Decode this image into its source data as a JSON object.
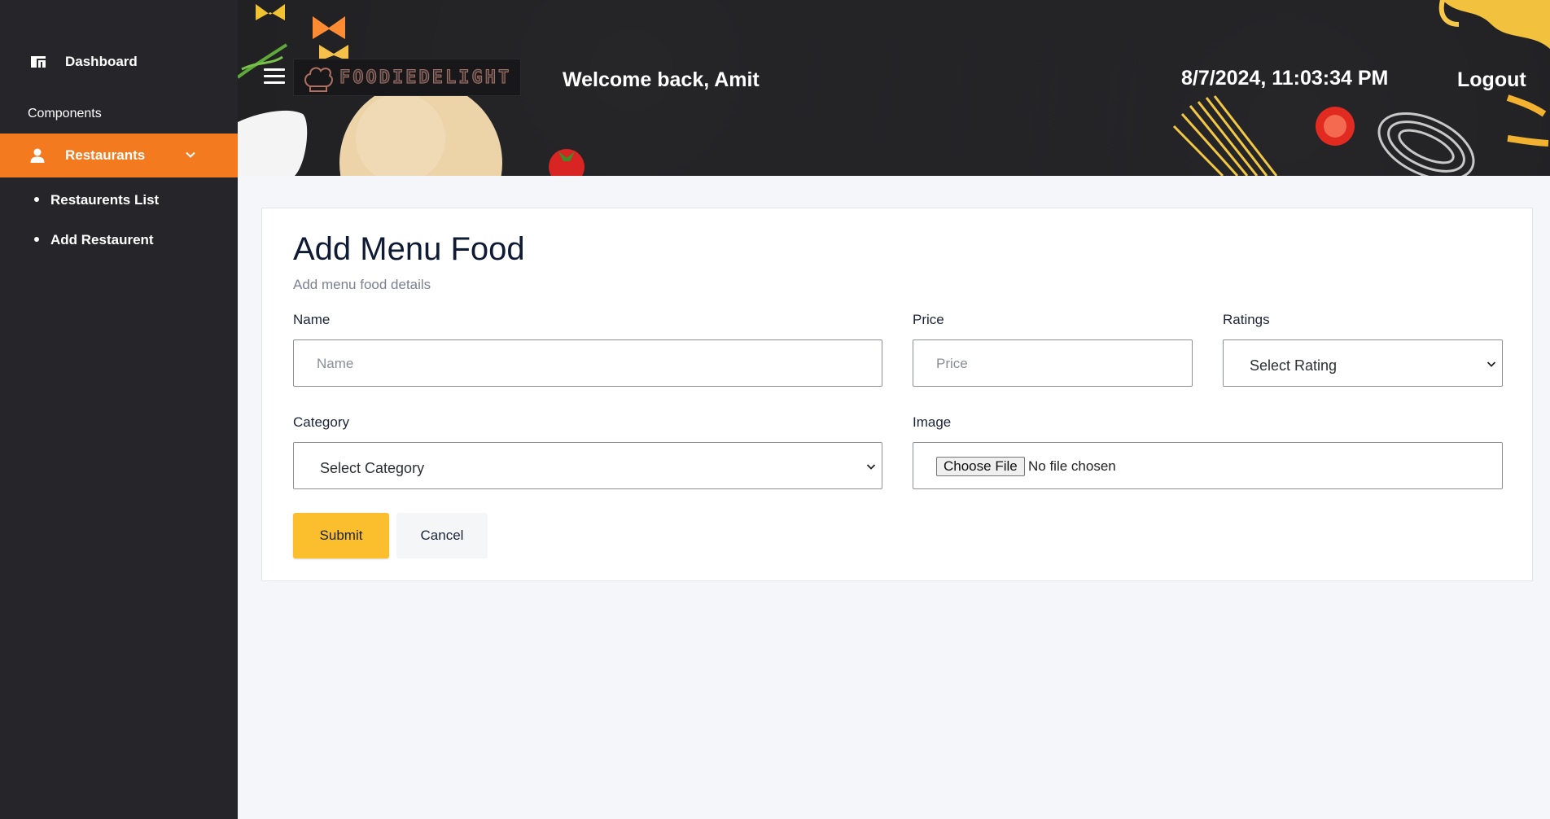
{
  "sidebar": {
    "dashboard_label": "Dashboard",
    "section_label": "Components",
    "restaurants_label": "Restaurants",
    "sub_items": [
      {
        "label": "Restaurents List"
      },
      {
        "label": "Add Restaurent"
      }
    ],
    "accent_color": "#f47a1f",
    "background_color": "#26262a"
  },
  "header": {
    "logo_text": "FOODIEDELIGHT",
    "welcome_text": "Welcome back, Amit",
    "datetime": "8/7/2024, 11:03:34 PM",
    "logout_label": "Logout"
  },
  "form": {
    "title": "Add Menu Food",
    "subtitle": "Add menu food details",
    "name": {
      "label": "Name",
      "placeholder": "Name"
    },
    "price": {
      "label": "Price",
      "placeholder": "Price"
    },
    "ratings": {
      "label": "Ratings",
      "selected": "Select Rating"
    },
    "category": {
      "label": "Category",
      "selected": "Select Category"
    },
    "image": {
      "label": "Image",
      "button_label": "Choose File",
      "status": "No file chosen"
    },
    "submit_label": "Submit",
    "cancel_label": "Cancel",
    "submit_color": "#fbbf2d"
  }
}
